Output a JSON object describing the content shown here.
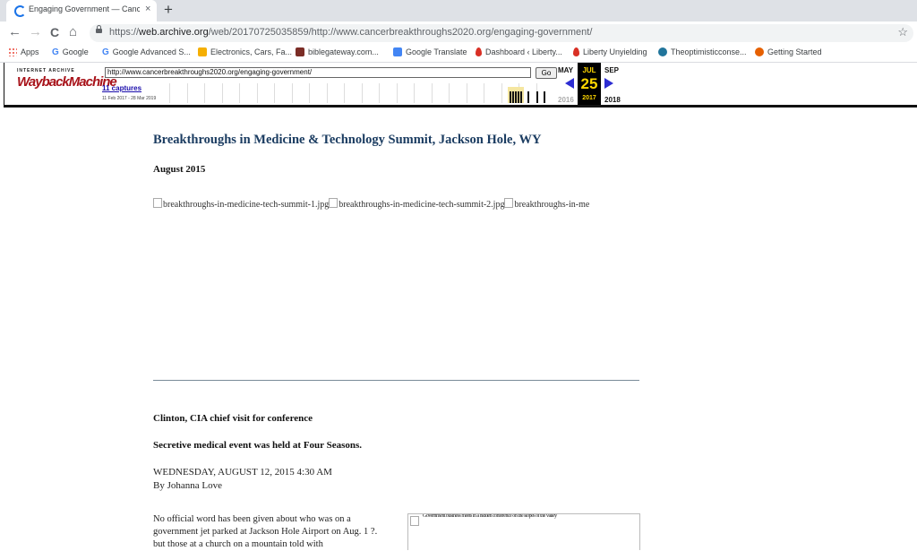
{
  "browser": {
    "tab_title": "Engaging Government — Cancer",
    "tab_close": "×",
    "new_tab": "+",
    "url_prefix": "https://",
    "url_host": "web.archive.org",
    "url_path": "/web/20170725035859/http://www.cancerbreakthroughs2020.org/engaging-government/",
    "nav": {
      "back": "←",
      "forward": "→",
      "reload": "C",
      "home": "⌂"
    },
    "star": "☆"
  },
  "bookmarks": [
    {
      "label": "Apps",
      "icon": "apps-grid-icon",
      "color": "#ea4335"
    },
    {
      "label": "Google",
      "icon": "google-icon",
      "color": "#4285f4"
    },
    {
      "label": "Google Advanced S...",
      "icon": "google-icon",
      "color": "#4285f4"
    },
    {
      "label": "Electronics, Cars, Fa...",
      "icon": "ebay-icon",
      "color": "#f5af02"
    },
    {
      "label": "biblegateway.com...",
      "icon": "bible-icon",
      "color": "#7b2d26"
    },
    {
      "label": "Google Translate",
      "icon": "translate-icon",
      "color": "#4285f4"
    },
    {
      "label": "Dashboard ‹ Liberty...",
      "icon": "flame-icon",
      "color": "#d93025"
    },
    {
      "label": "Liberty Unyielding",
      "icon": "flame-icon",
      "color": "#d93025"
    },
    {
      "label": "Theoptimisticconse...",
      "icon": "wordpress-icon",
      "color": "#21759b"
    },
    {
      "label": "Getting Started",
      "icon": "firefox-icon",
      "color": "#e66000"
    }
  ],
  "wayback": {
    "logo_top": "INTERNET ARCHIVE",
    "logo_main": "WaybackMachine",
    "url_value": "http://www.cancerbreakthroughs2020.org/engaging-government/",
    "go_label": "Go",
    "captures": "11 captures",
    "range": "11 Feb 2017 - 28 Mar 2019",
    "prev_month": "MAY",
    "cur_month": "JUL",
    "next_month": "SEP",
    "cur_day": "25",
    "prev_year": "2016",
    "cur_year": "2017",
    "next_year": "2018"
  },
  "article": {
    "title": "Breakthroughs in Medicine & Technology Summit, Jackson Hole, WY",
    "date": "August 2015",
    "images": [
      "breakthroughs-in-medicine-tech-summit-1.jpg",
      "breakthroughs-in-medicine-tech-summit-2.jpg",
      "breakthroughs-in-me"
    ],
    "sub1": "Clinton, CIA chief visit for conference",
    "sub2": "Secretive medical event was held at Four Seasons.",
    "dateline": "WEDNESDAY, AUGUST 12, 2015 4:30 AM",
    "byline": "By Johanna Love",
    "para": "No official word has been given about who was on a government jet parked at Jackson Hole Airport on Aug. 1 ?. but those at a church on a mountain told with",
    "figcap": "Government business meets in a hidden conference on the slopes of the valley"
  }
}
